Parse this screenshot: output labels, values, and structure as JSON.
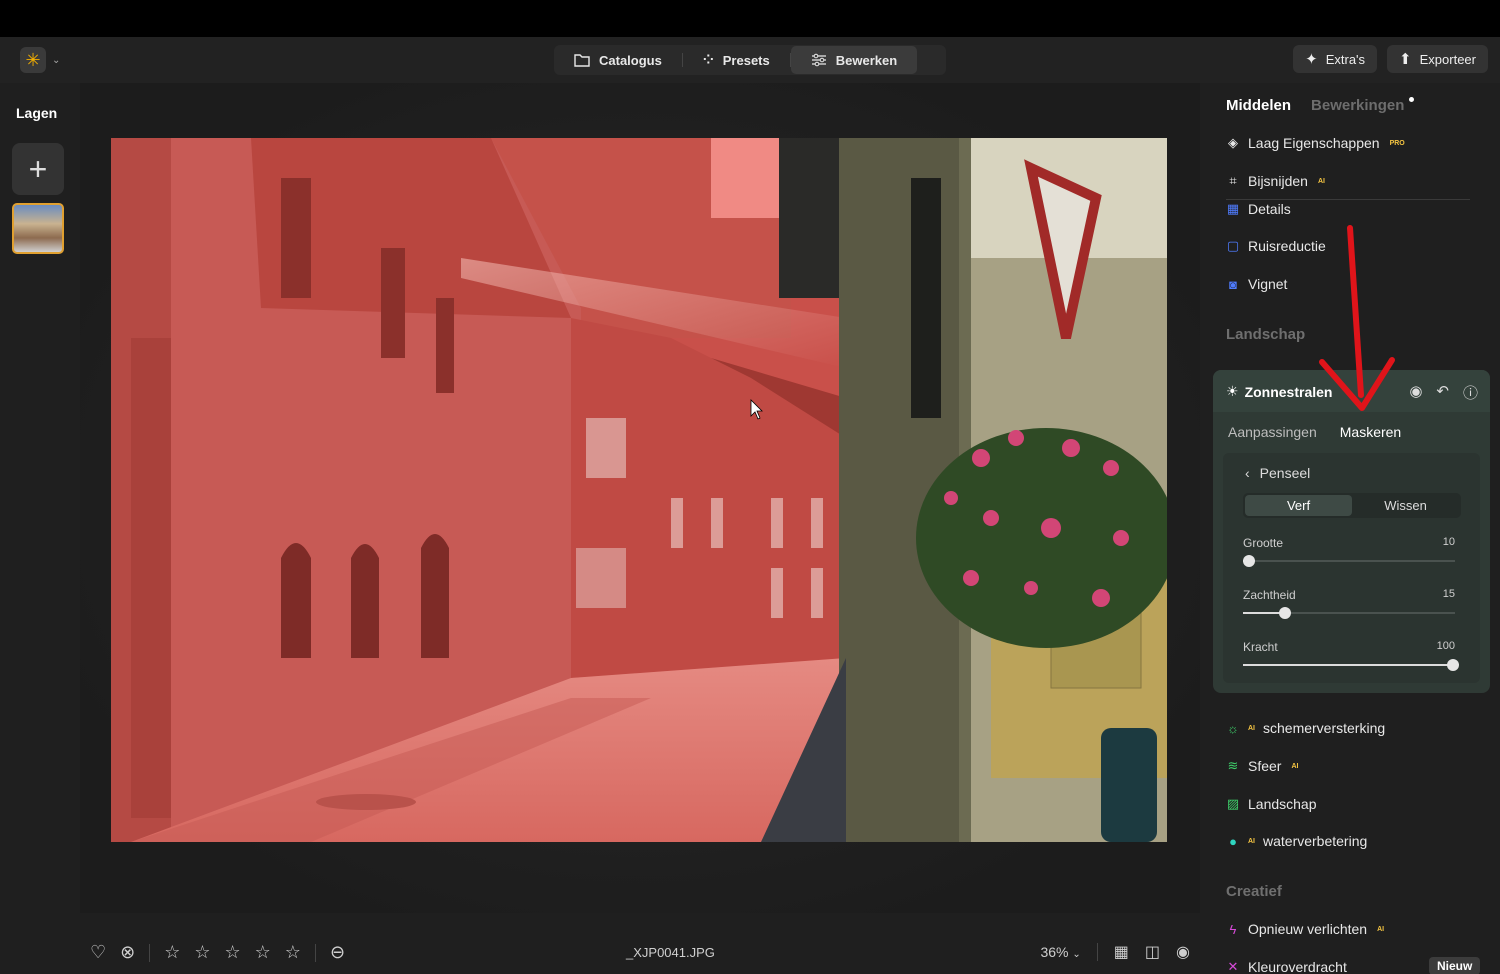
{
  "topbar": {
    "modes": [
      {
        "label": "Catalogus",
        "icon": "folder-icon"
      },
      {
        "label": "Presets",
        "icon": "sparkle-icon"
      },
      {
        "label": "Bewerken",
        "icon": "sliders-icon"
      }
    ],
    "extras_label": "Extra's",
    "export_label": "Exporteer"
  },
  "layers": {
    "title": "Lagen"
  },
  "panel": {
    "tab_tools": "Middelen",
    "tab_edits": "Bewerkingen",
    "tools_top": [
      {
        "label": "Laag Eigenschappen",
        "badge": "PRO",
        "icon": "layers-icon"
      },
      {
        "label": "Bijsnijden",
        "badge": "AI",
        "icon": "crop-icon"
      },
      {
        "label": "Details",
        "badge": "",
        "icon": "details-icon"
      },
      {
        "label": "Ruisreductie",
        "badge": "",
        "icon": "noise-icon"
      },
      {
        "label": "Vignet",
        "badge": "",
        "icon": "vignette-icon"
      }
    ],
    "section_landscape": "Landschap",
    "card": {
      "title": "Zonnestralen",
      "subtab_adjust": "Aanpassingen",
      "subtab_mask": "Maskeren",
      "back_label": "Penseel",
      "seg_paint": "Verf",
      "seg_erase": "Wissen",
      "sliders": [
        {
          "label": "Grootte",
          "value": "10",
          "fraction": 0.0
        },
        {
          "label": "Zachtheid",
          "value": "15",
          "fraction": 0.17
        },
        {
          "label": "Kracht",
          "value": "100",
          "fraction": 0.96
        }
      ]
    },
    "tools_landscape": [
      {
        "label": "schemerversterking",
        "badge_before": "AI"
      },
      {
        "label": "Sfeer",
        "badge": "AI"
      },
      {
        "label": "Landschap",
        "badge": ""
      },
      {
        "label": "waterverbetering",
        "badge_before": "AI"
      }
    ],
    "section_creative": "Creatief",
    "tools_creative": [
      {
        "label": "Opnieuw verlichten",
        "badge": "AI"
      },
      {
        "label": "Kleuroverdracht",
        "badge": "",
        "tag": "Nieuw"
      }
    ]
  },
  "bottombar": {
    "filename": "_XJP0041.JPG",
    "zoom": "36%"
  },
  "colors": {
    "accent_yellow": "#f5b000",
    "mask_red": "#e04a44",
    "card_bg": "#2f3a35"
  }
}
